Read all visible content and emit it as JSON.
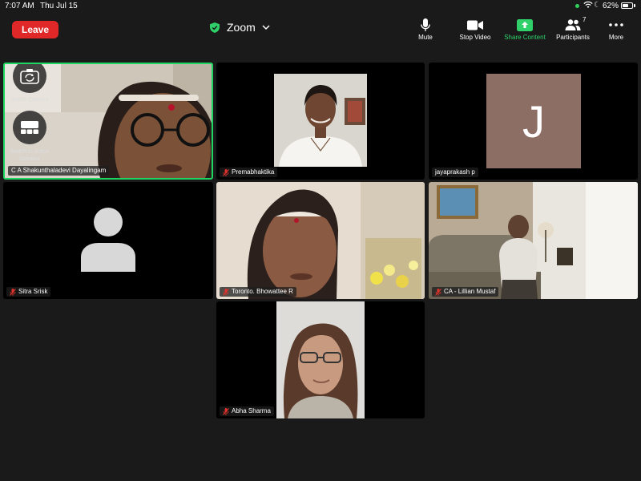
{
  "status": {
    "time": "7:07 AM",
    "date": "Thu Jul 15",
    "battery": "62%",
    "battery_level": 0.62
  },
  "header": {
    "leave_label": "Leave",
    "title": "Zoom",
    "toolbar": {
      "mute": "Mute",
      "stop_video": "Stop Video",
      "share_content": "Share Content",
      "participants": "Participants",
      "participants_count": "7",
      "more": "More"
    }
  },
  "overlay": {
    "switch_camera": "Switch Camera",
    "switch_view": "Switch to Active Speaker"
  },
  "participants": [
    {
      "name": "C A Shakunthaladevi Dayalingam"
    },
    {
      "name": "Premabhaktika"
    },
    {
      "name": "jayaprakash p",
      "initial": "J"
    },
    {
      "name": "Sitra Srisk"
    },
    {
      "name": "Toronto. Bhowattee R"
    },
    {
      "name": "CA - Lillian Mustaf"
    },
    {
      "name": "Abha Sharma"
    }
  ],
  "colors": {
    "leave": "#e02828",
    "active_border": "#1ed760",
    "share_green": "#2fd06a",
    "avatar_j": "#8c6e65"
  }
}
